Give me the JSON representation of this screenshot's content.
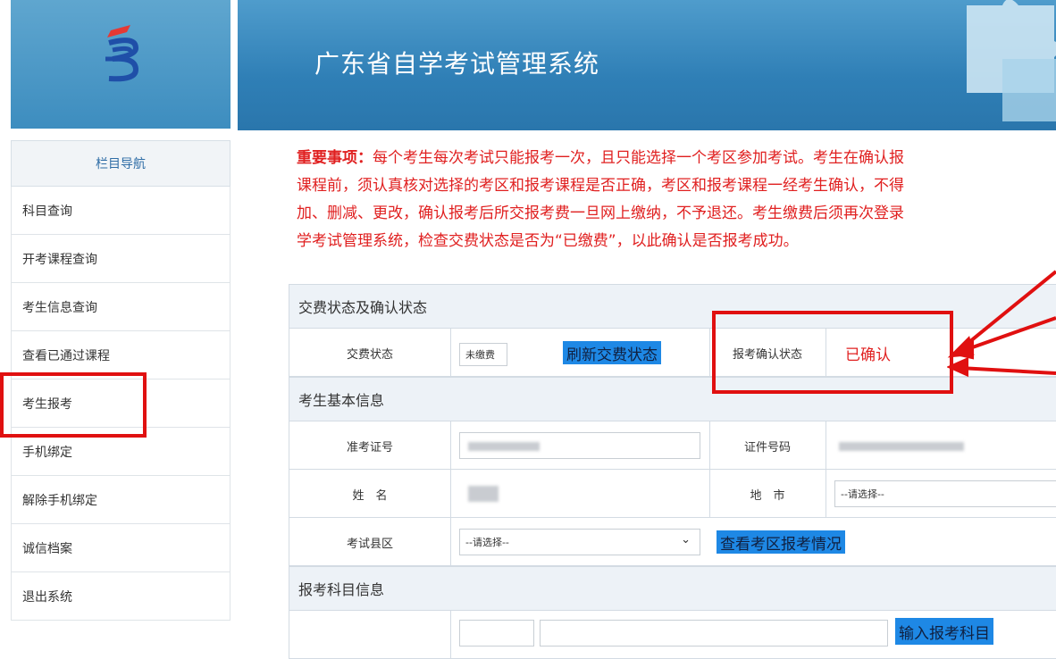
{
  "header": {
    "title": "广东省自学考试管理系统"
  },
  "sidebar": {
    "heading": "栏目导航",
    "items": [
      {
        "label": "科目查询"
      },
      {
        "label": "开考课程查询"
      },
      {
        "label": "考生信息查询"
      },
      {
        "label": "查看已通过课程"
      },
      {
        "label": "考生报考"
      },
      {
        "label": "手机绑定"
      },
      {
        "label": "解除手机绑定"
      },
      {
        "label": "诚信档案"
      },
      {
        "label": "退出系统"
      }
    ]
  },
  "notice": {
    "prefix": "重要事项：",
    "lines": [
      "每个考生每次考试只能报考一次，且只能选择一个考区参加考试。考生在确认报",
      "课程前，须认真核对选择的考区和报考课程是否正确，考区和报考课程一经考生确认，不得",
      "加、删减、更改，确认报考后所交报考费一旦网上缴纳，不予退还。考生缴费后须再次登录",
      "学考试管理系统，检查交费状态是否为“已缴费”，以此确认是否报考成功。"
    ]
  },
  "payment_section": {
    "title": "交费状态及确认状态",
    "fee_status_label": "交费状态",
    "fee_status_value": "未缴费",
    "refresh_button": "刷新交费状态",
    "confirm_status_label": "报考确认状态",
    "confirm_status_value": "已确认"
  },
  "basic_section": {
    "title": "考生基本信息",
    "admission_label": "准考证号",
    "id_label": "证件号码",
    "name_label": "姓　名",
    "city_label": "地　市",
    "city_select": "--请选择--",
    "county_label": "考试县区",
    "county_select": "--请选择--",
    "view_button": "查看考区报考情况"
  },
  "subject_section": {
    "title": "报考科目信息",
    "enter_button": "输入报考科目"
  },
  "colors": {
    "accent_red": "#e02020",
    "button_blue": "#1e88e5",
    "banner_blue": "#3d8dbf"
  }
}
